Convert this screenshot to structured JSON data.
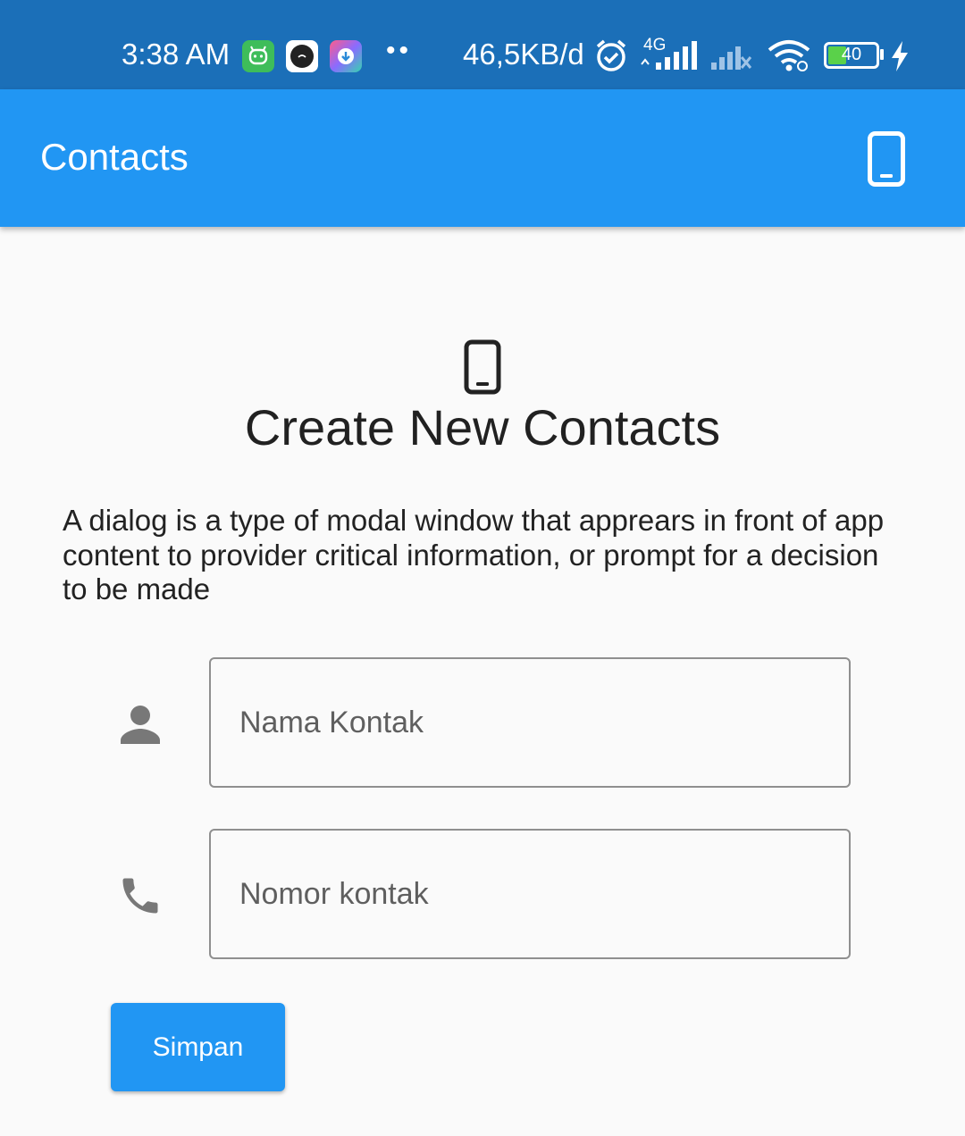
{
  "status_bar": {
    "time": "3:38 AM",
    "notification_icons": [
      "android-robot-icon",
      "camera-app-icon",
      "download-app-icon"
    ],
    "more": "••",
    "net_speed": "46,5KB/d",
    "network_type": "4G",
    "battery_level": "40"
  },
  "app_bar": {
    "title": "Contacts",
    "action_icon": "smartphone-icon"
  },
  "main": {
    "hero_icon": "smartphone-icon",
    "title": "Create New Contacts",
    "description": "A dialog is a type of modal window that apprears in front of app content to provider critical information, or prompt for a decision to be made",
    "fields": [
      {
        "icon": "person-icon",
        "placeholder": "Nama Kontak",
        "value": ""
      },
      {
        "icon": "phone-icon",
        "placeholder": "Nomor kontak",
        "value": ""
      }
    ],
    "save_label": "Simpan"
  },
  "colors": {
    "status_bar": "#1b6fb8",
    "primary": "#2196f3",
    "background": "#fafafa"
  }
}
